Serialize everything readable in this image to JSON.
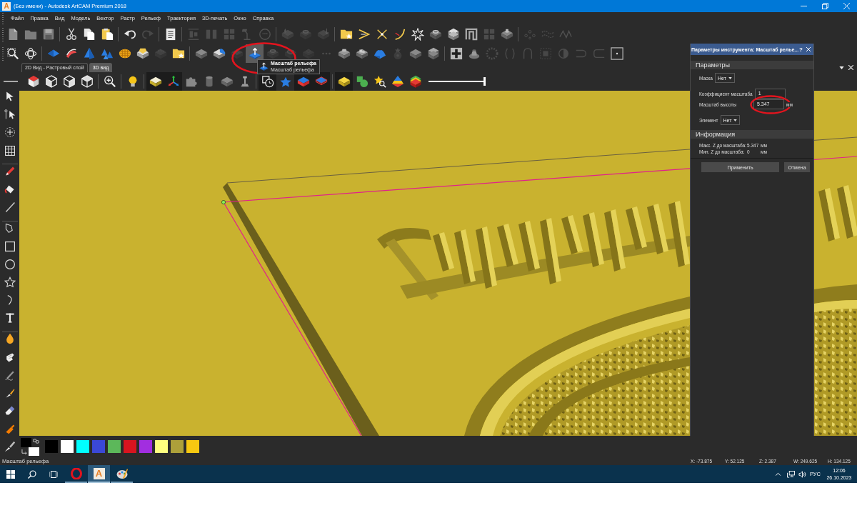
{
  "title_bar": {
    "app_letter": "A",
    "title": "(Без имени) - Autodesk ArtCAM Premium 2018"
  },
  "menu": [
    "Файл",
    "Правка",
    "Вид",
    "Модель",
    "Вектор",
    "Растр",
    "Рельеф",
    "Траектория",
    "3D-печать",
    "Окно",
    "Справка"
  ],
  "toolbar_1": [
    {
      "disabled": false
    },
    {
      "disabled": false
    },
    {
      "disabled": false
    },
    {
      "disabled": false
    },
    {
      "disabled": false
    },
    {
      "disabled": false
    },
    {
      "disabled": false
    },
    {
      "disabled": true
    },
    {
      "disabled": false
    },
    {
      "disabled": true
    },
    {
      "disabled": true
    },
    {
      "disabled": true
    },
    {
      "disabled": true
    },
    {
      "disabled": true
    },
    {
      "disabled": true
    },
    {
      "disabled": true
    },
    {
      "disabled": true
    },
    {
      "disabled": false
    },
    {
      "disabled": false
    },
    {
      "disabled": false
    },
    {
      "disabled": false
    },
    {
      "disabled": false
    },
    {
      "disabled": false
    },
    {
      "disabled": false
    },
    {
      "disabled": false
    },
    {
      "disabled": true
    },
    {
      "disabled": false
    },
    {
      "disabled": true
    },
    {
      "disabled": true
    },
    {
      "disabled": true
    }
  ],
  "toolbar_2": [
    {
      "disabled": false,
      "hovered": false,
      "circled": false
    },
    {
      "disabled": false,
      "hovered": false,
      "circled": false
    },
    {
      "disabled": false,
      "hovered": false,
      "circled": false
    },
    {
      "disabled": false,
      "hovered": false,
      "circled": false
    },
    {
      "disabled": false,
      "hovered": false,
      "circled": false
    },
    {
      "disabled": false,
      "hovered": false,
      "circled": false
    },
    {
      "disabled": false,
      "hovered": false,
      "circled": false
    },
    {
      "disabled": false,
      "hovered": false,
      "circled": false
    },
    {
      "disabled": true,
      "hovered": false,
      "circled": false
    },
    {
      "disabled": false,
      "hovered": false,
      "circled": false
    },
    {
      "disabled": false,
      "hovered": false,
      "circled": false
    },
    {
      "disabled": false,
      "hovered": false,
      "circled": false
    },
    {
      "disabled": true,
      "hovered": false,
      "circled": false
    },
    {
      "disabled": false,
      "hovered": true,
      "circled": true
    },
    {
      "disabled": true,
      "hovered": false,
      "circled": false
    },
    {
      "disabled": true,
      "hovered": false,
      "circled": false
    },
    {
      "disabled": true,
      "hovered": false,
      "circled": false
    },
    {
      "disabled": true,
      "hovered": false,
      "circled": false
    },
    {
      "disabled": false,
      "hovered": false,
      "circled": false
    },
    {
      "disabled": false,
      "hovered": false,
      "circled": false
    },
    {
      "disabled": false,
      "hovered": false,
      "circled": false
    },
    {
      "disabled": true,
      "hovered": false,
      "circled": false
    },
    {
      "disabled": false,
      "hovered": false,
      "circled": false
    },
    {
      "disabled": false,
      "hovered": false,
      "circled": false
    },
    {
      "disabled": false,
      "hovered": false,
      "circled": false
    },
    {
      "disabled": false,
      "hovered": false,
      "circled": false
    },
    {
      "disabled": true,
      "hovered": false,
      "circled": false
    },
    {
      "disabled": true,
      "hovered": false,
      "circled": false
    },
    {
      "disabled": true,
      "hovered": false,
      "circled": false
    },
    {
      "disabled": true,
      "hovered": false,
      "circled": false
    },
    {
      "disabled": true,
      "hovered": false,
      "circled": false
    },
    {
      "disabled": true,
      "hovered": false,
      "circled": false
    },
    {
      "disabled": true,
      "hovered": false,
      "circled": false
    },
    {
      "disabled": false,
      "hovered": false,
      "circled": false
    }
  ],
  "tooltip": {
    "title": "Масштаб рельефа",
    "text": "Масштаб рельефа"
  },
  "view_tabs": [
    {
      "label": "2D Вид - Растровый слой",
      "selected": false
    },
    {
      "label": "3D вид",
      "selected": true
    }
  ],
  "view_toolbar": {
    "items": [
      {
        "on": false
      },
      {
        "on": false
      },
      {
        "on": false
      },
      {
        "on": false
      },
      {
        "on": false
      },
      {
        "on": false
      },
      {
        "on": true
      },
      {
        "on": true
      },
      {
        "on": false
      },
      {
        "on": false
      },
      {
        "on": false
      },
      {
        "on": false
      },
      {
        "on": true
      },
      {
        "on": false
      },
      {
        "on": true
      },
      {
        "on": true
      },
      {
        "on": true
      },
      {
        "on": false
      },
      {
        "on": false
      },
      {
        "on": false
      },
      {
        "on": false
      }
    ],
    "slider": {
      "level": 1
    }
  },
  "tool_panel": {
    "title": "Параметры инструмента: Масштаб релье...",
    "help": "?",
    "parameters": {
      "title": "Параметры",
      "rows": [
        {
          "kind": "dropdown",
          "label": "Маска",
          "value": "Нет"
        },
        {
          "kind": "number",
          "label": "Коэффициент масштаба",
          "value": "1",
          "circled": false
        },
        {
          "kind": "number",
          "label": "Масштаб высоты",
          "value": "5.347",
          "unit": "мм",
          "circled": true
        },
        {
          "kind": "dropdown",
          "label": "Элемент",
          "value": "Нет"
        }
      ]
    },
    "information": {
      "title": "Информация",
      "rows": [
        {
          "label": "Макс. Z до масштаба:",
          "value": "5.347",
          "unit": "мм"
        },
        {
          "label": "Мин. Z до масштаба:",
          "value": "0",
          "unit": "мм"
        }
      ]
    },
    "buttons": [
      {
        "label": "Применить"
      },
      {
        "label": "Отмена"
      }
    ]
  },
  "palette": {
    "foreground": {
      "color": "#000000"
    },
    "background": {
      "color": "#ffffff"
    },
    "swatches": [
      {
        "color": "#000000"
      },
      {
        "color": "#ffffff"
      },
      {
        "color": "#00ffff"
      },
      {
        "color": "#3a48d6"
      },
      {
        "color": "#5cb85a"
      },
      {
        "color": "#d8141f"
      },
      {
        "color": "#a22ee0"
      },
      {
        "color": "#ffff80"
      },
      {
        "color": "#ada03a"
      },
      {
        "color": "#f7c811"
      }
    ]
  },
  "status_bar": {
    "text": "Масштаб рельефа",
    "coordinates": [
      "X: -73.875",
      "Y: 52.125",
      "Z: 2.387",
      "W: 249.625",
      "H: 134.125"
    ]
  },
  "taskbar": {
    "apps": [
      {
        "kind": "browser",
        "selected": false
      },
      {
        "kind": "cad",
        "letter": "A",
        "selected": true
      },
      {
        "kind": "paint",
        "selected": false
      }
    ],
    "language": "РУС",
    "time": "12:06",
    "date": "26.10.2023"
  }
}
